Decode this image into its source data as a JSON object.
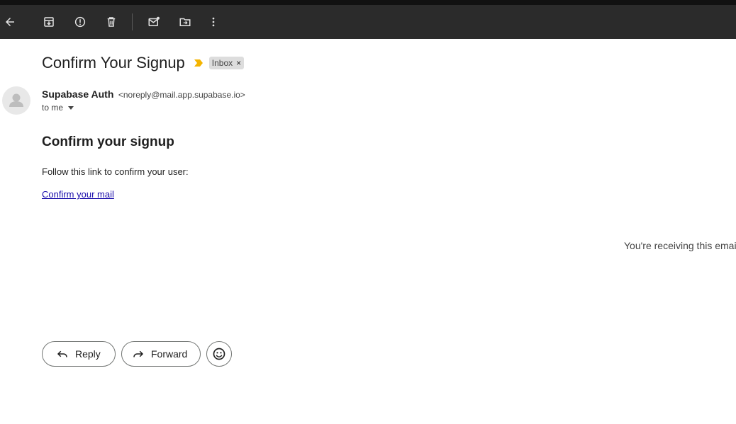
{
  "toolbar": {
    "icons": [
      "back-arrow-icon",
      "archive-icon",
      "report-spam-icon",
      "delete-icon",
      "mark-unread-icon",
      "move-to-icon",
      "more-options-icon"
    ]
  },
  "email": {
    "subject": "Confirm Your Signup",
    "labels": [
      {
        "name": "Inbox"
      }
    ],
    "sender_name": "Supabase Auth",
    "sender_email": "<noreply@mail.app.supabase.io>",
    "recipient": "to me",
    "body_heading": "Confirm your signup",
    "body_text": "Follow this link to confirm your user:",
    "body_link": "Confirm your mail",
    "footer_note": "You're receiving this emai"
  },
  "actions": {
    "reply_label": "Reply",
    "forward_label": "Forward"
  },
  "colors": {
    "toolbar_bg": "#2b2b2b",
    "important_marker": "#f4b400",
    "link": "#1a0dab"
  }
}
